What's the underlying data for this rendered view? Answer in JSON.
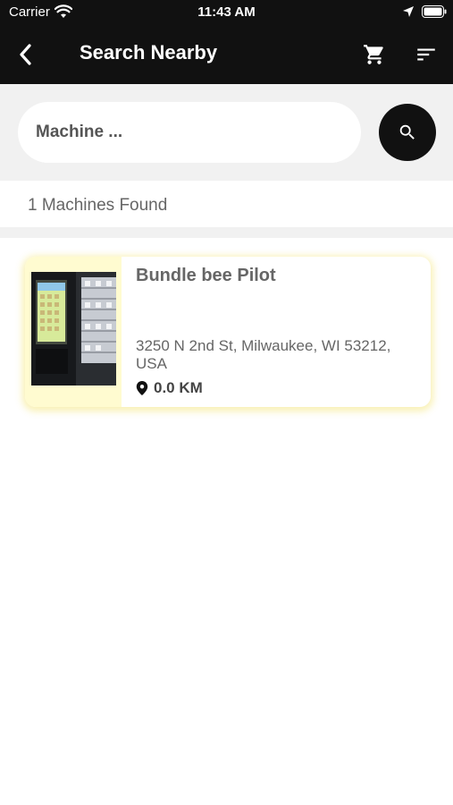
{
  "status_bar": {
    "carrier": "Carrier",
    "time": "11:43 AM"
  },
  "nav": {
    "title": "Search Nearby",
    "back_icon": "chevron-left-icon",
    "cart_icon": "cart-icon",
    "filter_icon": "sort-icon"
  },
  "search": {
    "placeholder": "Machine ...",
    "value": "",
    "button_icon": "search-icon"
  },
  "results": {
    "count_text": "1 Machines Found",
    "items": [
      {
        "name": "Bundle bee Pilot",
        "address": "3250 N 2nd St, Milwaukee, WI 53212, USA",
        "distance": "0.0 KM"
      }
    ]
  },
  "colors": {
    "header_bg": "#111111",
    "page_bg": "#f1f1f1",
    "card_glow": "#f8eeaa",
    "text_muted": "#666666"
  }
}
